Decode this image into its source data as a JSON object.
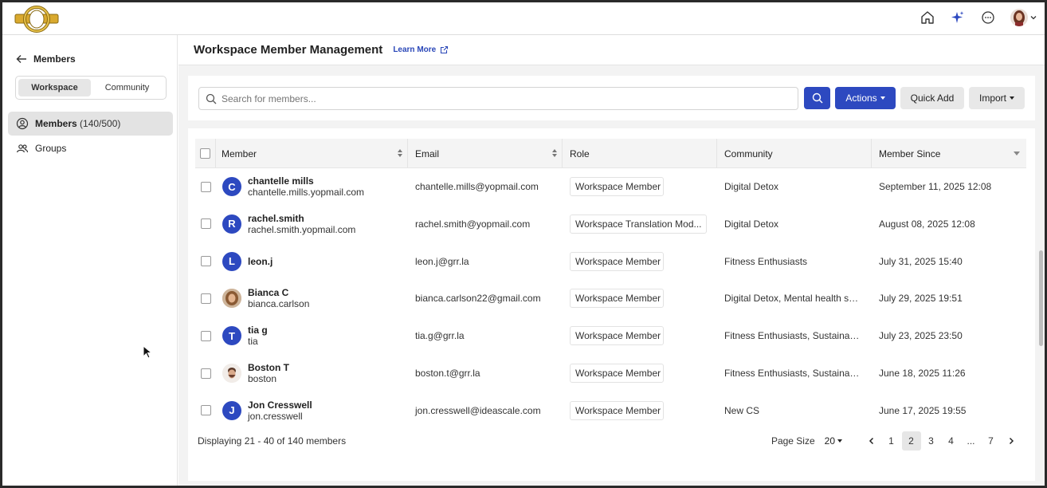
{
  "sidebar": {
    "back_label": "Members",
    "segments": [
      "Workspace",
      "Community"
    ],
    "nav": [
      {
        "label": "Members",
        "count": "(140/500)"
      },
      {
        "label": "Groups"
      }
    ]
  },
  "header": {
    "title": "Workspace Member Management",
    "learn_more": "Learn More"
  },
  "toolbar": {
    "search_placeholder": "Search for members...",
    "actions_label": "Actions",
    "quick_add_label": "Quick Add",
    "import_label": "Import"
  },
  "table": {
    "columns": [
      "Member",
      "Email",
      "Role",
      "Community",
      "Member Since"
    ],
    "rows": [
      {
        "initial": "C",
        "name": "chantelle mills",
        "username": "chantelle.mills.yopmail.com",
        "email": "chantelle.mills@yopmail.com",
        "role": "Workspace Member",
        "community": "Digital Detox",
        "since": "September 11, 2025 12:08"
      },
      {
        "initial": "R",
        "name": "rachel.smith",
        "username": "rachel.smith.yopmail.com",
        "email": "rachel.smith@yopmail.com",
        "role": "Workspace Translation Mod...",
        "community": "Digital Detox",
        "since": "August 08, 2025 12:08"
      },
      {
        "initial": "L",
        "name": "leon.j",
        "username": "",
        "email": "leon.j@grr.la",
        "role": "Workspace Member",
        "community": "Fitness Enthusiasts",
        "since": "July 31, 2025 15:40"
      },
      {
        "initial": "",
        "photo": "woman",
        "name": "Bianca C",
        "username": "bianca.carlson",
        "email": "bianca.carlson22@gmail.com",
        "role": "Workspace Member",
        "community": "Digital Detox, Mental health su...",
        "since": "July 29, 2025 19:51"
      },
      {
        "initial": "T",
        "name": "tia g",
        "username": "tia",
        "email": "tia.g@grr.la",
        "role": "Workspace Member",
        "community": "Fitness Enthusiasts, Sustainab...",
        "since": "July 23, 2025 23:50"
      },
      {
        "initial": "",
        "photo": "man",
        "name": "Boston T",
        "username": "boston",
        "email": "boston.t@grr.la",
        "role": "Workspace Member",
        "community": "Fitness Enthusiasts, Sustainab...",
        "since": "June 18, 2025 11:26"
      },
      {
        "initial": "J",
        "name": "Jon Cresswell",
        "username": "jon.cresswell",
        "email": "jon.cresswell@ideascale.com",
        "role": "Workspace Member",
        "community": "New CS",
        "since": "June 17, 2025 19:55"
      }
    ]
  },
  "footer": {
    "displaying": "Displaying 21 - 40 of 140 members",
    "page_size_label": "Page Size",
    "page_size": "20",
    "pages": [
      "1",
      "2",
      "3",
      "4",
      "...",
      "7"
    ],
    "current_page": "2"
  },
  "colors": {
    "primary": "#2d49c0",
    "link": "#2a47b8"
  }
}
